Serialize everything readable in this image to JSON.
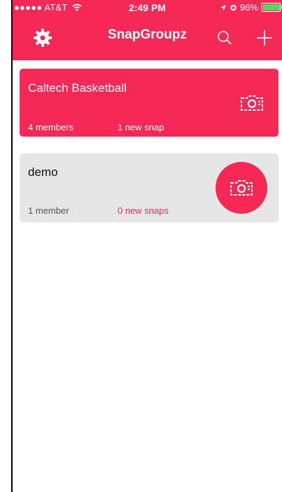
{
  "status_bar": {
    "carrier": "●●●●● AT&T",
    "time": "2:49 PM",
    "battery": "96%",
    "battery_level": 0.96
  },
  "header": {
    "title": "SnapGroupz",
    "settings_icon": "gear-icon",
    "search_icon": "search-icon",
    "add_icon": "plus-icon"
  },
  "groups": [
    {
      "name": "Caltech Basketball",
      "members": "4 members",
      "snaps": "1 new snap"
    },
    {
      "name": "demo",
      "members": "1 member",
      "snaps": "0 new snaps"
    }
  ],
  "colors": {
    "accent": "#f62856",
    "card_inactive": "#e6e6e6",
    "battery": "#4cd964"
  }
}
